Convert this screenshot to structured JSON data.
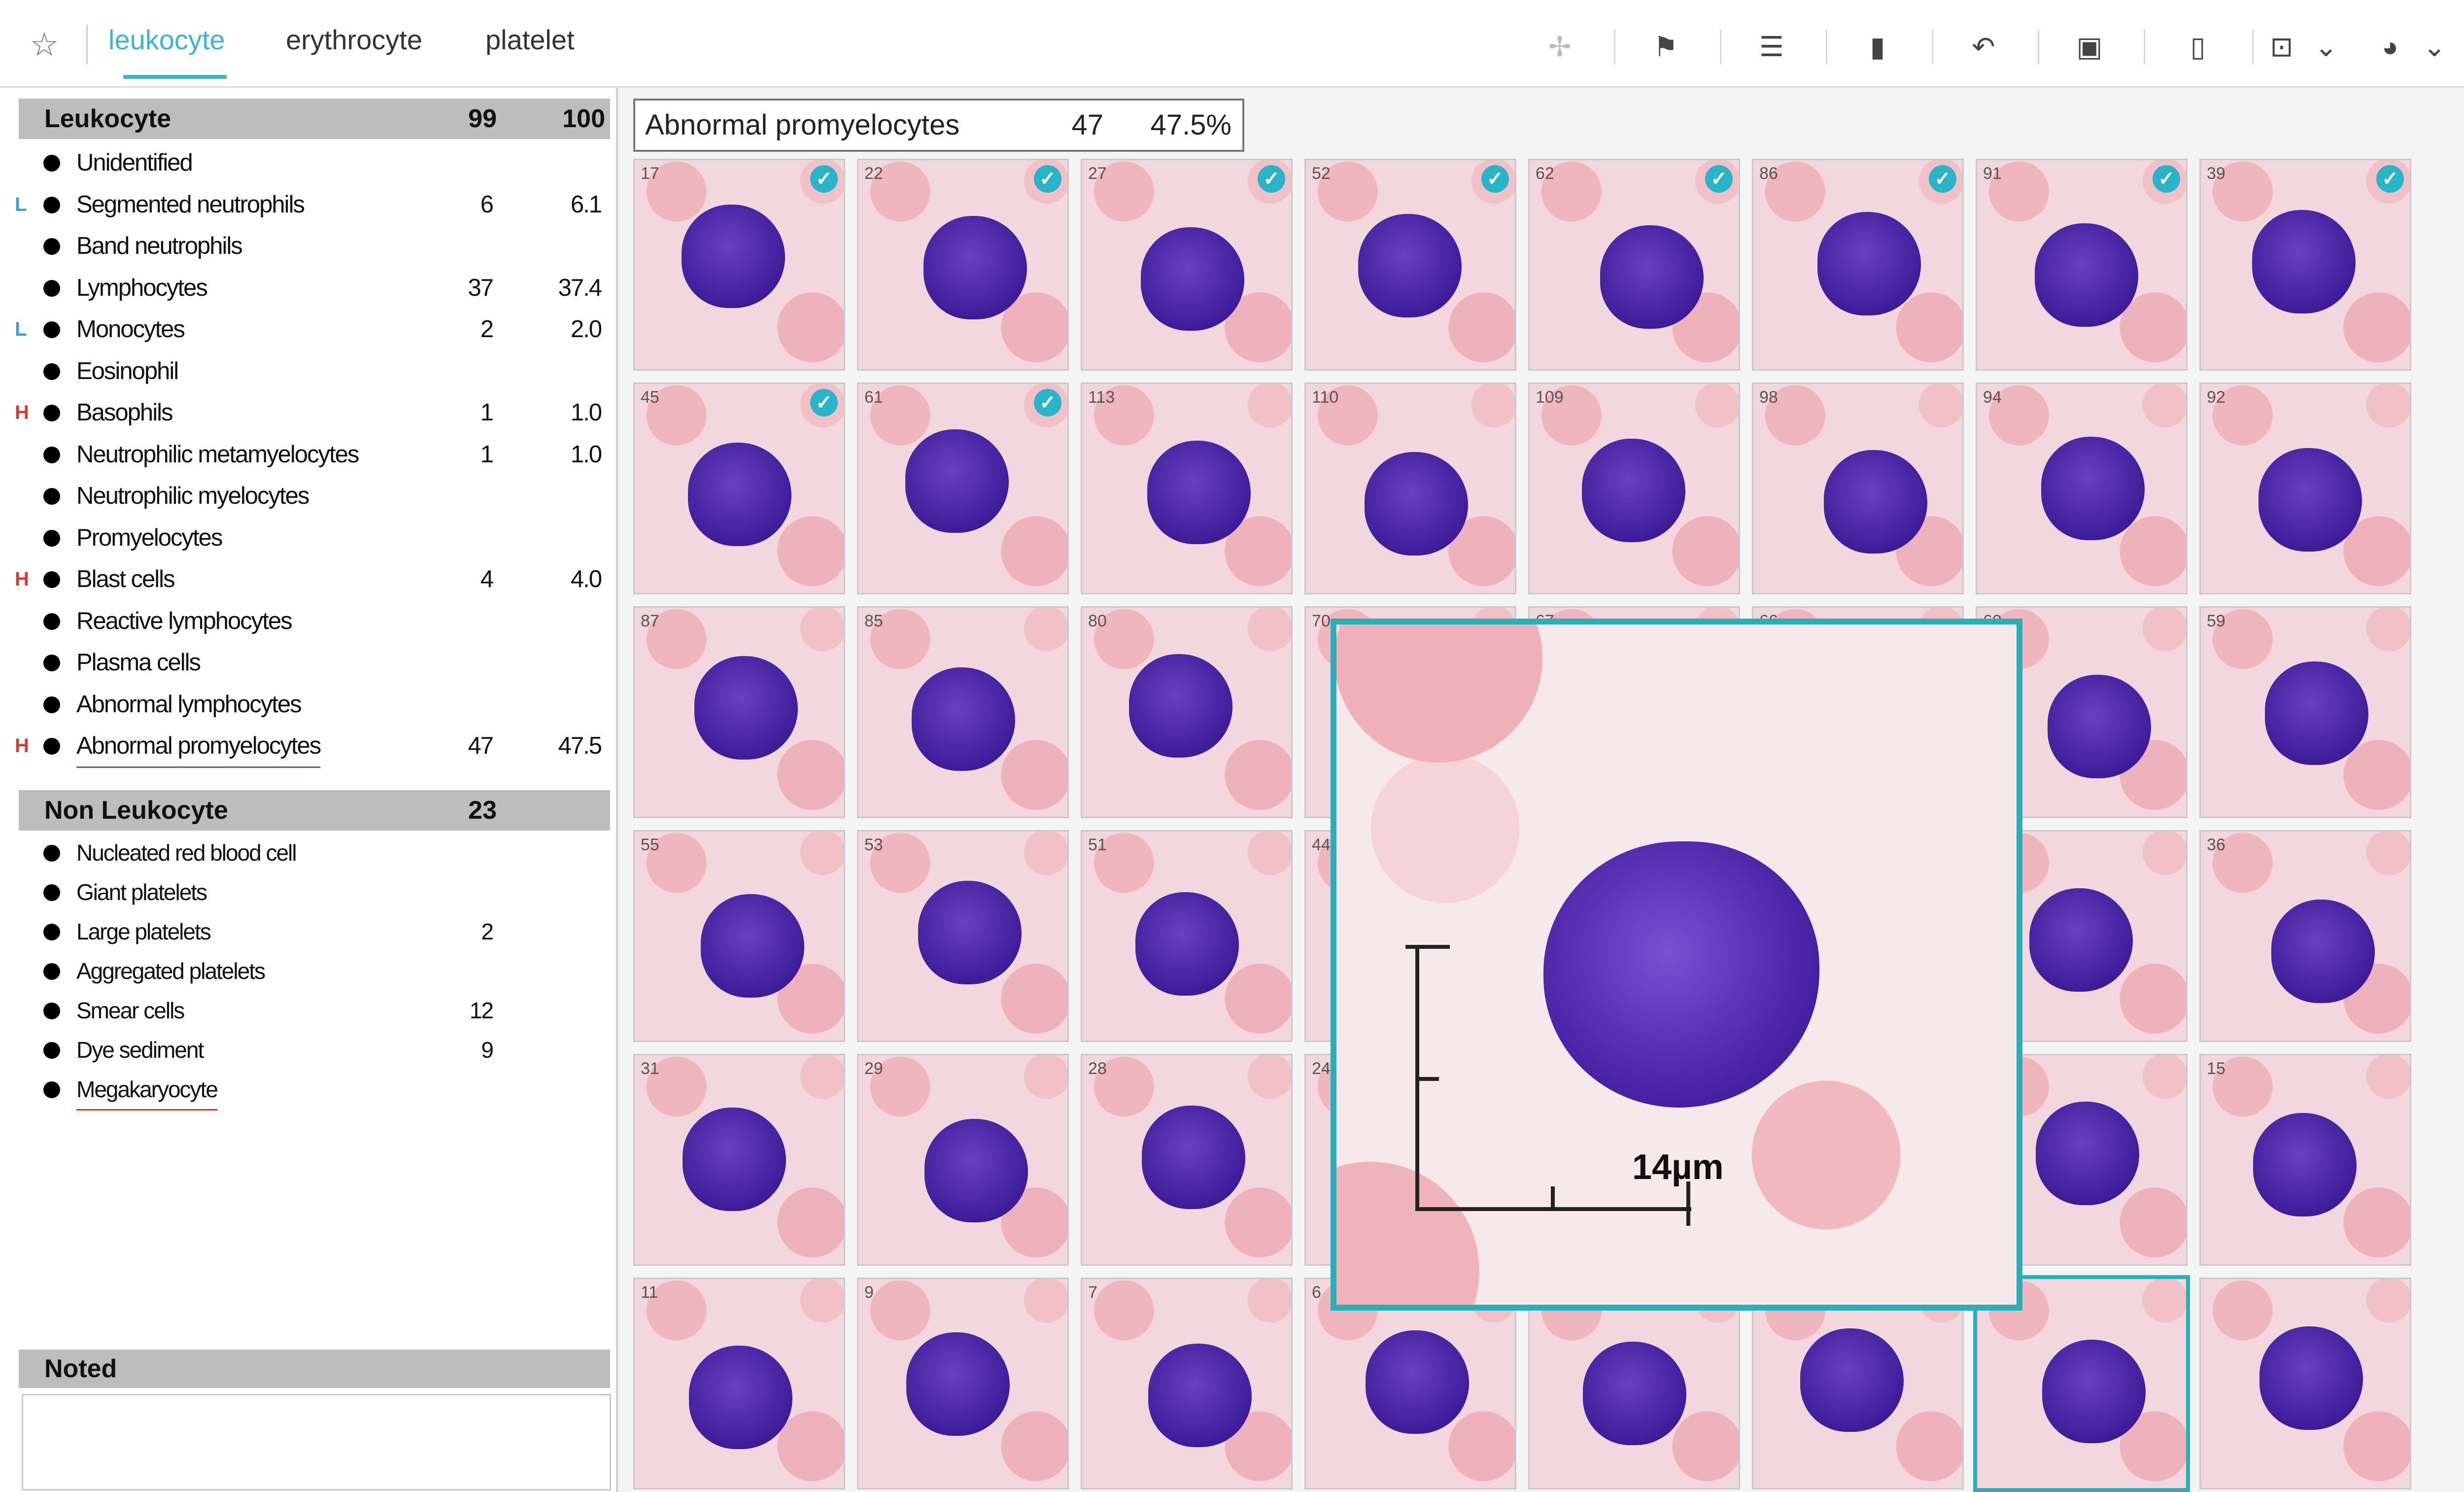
{
  "tabs": [
    {
      "label": "leukocyte"
    },
    {
      "label": "erythrocyte"
    },
    {
      "label": "platelet"
    }
  ],
  "leukocyte_group": {
    "title": "Leukocyte",
    "count": "99",
    "total": "100",
    "rows": [
      {
        "flag": "",
        "label": "Unidentified",
        "count": "",
        "percent": ""
      },
      {
        "flag": "L",
        "label": "Segmented neutrophils",
        "count": "6",
        "percent": "6.1"
      },
      {
        "flag": "",
        "label": "Band neutrophils",
        "count": "",
        "percent": ""
      },
      {
        "flag": "",
        "label": "Lymphocytes",
        "count": "37",
        "percent": "37.4"
      },
      {
        "flag": "L",
        "label": "Monocytes",
        "count": "2",
        "percent": "2.0"
      },
      {
        "flag": "",
        "label": "Eosinophil",
        "count": "",
        "percent": ""
      },
      {
        "flag": "H",
        "label": "Basophils",
        "count": "1",
        "percent": "1.0"
      },
      {
        "flag": "",
        "label": "Neutrophilic metamyelocytes",
        "count": "1",
        "percent": "1.0"
      },
      {
        "flag": "",
        "label": "Neutrophilic myelocytes",
        "count": "",
        "percent": ""
      },
      {
        "flag": "",
        "label": "Promyelocytes",
        "count": "",
        "percent": ""
      },
      {
        "flag": "H",
        "label": "Blast cells",
        "count": "4",
        "percent": "4.0"
      },
      {
        "flag": "",
        "label": "Reactive lymphocytes",
        "count": "",
        "percent": ""
      },
      {
        "flag": "",
        "label": "Plasma cells",
        "count": "",
        "percent": ""
      },
      {
        "flag": "",
        "label": "Abnormal lymphocytes",
        "count": "",
        "percent": ""
      },
      {
        "flag": "H",
        "label": "Abnormal promyelocytes",
        "count": "47",
        "percent": "47.5"
      }
    ]
  },
  "non_leukocyte_group": {
    "title": "Non Leukocyte",
    "count": "23",
    "rows": [
      {
        "label": "Nucleated red blood cell",
        "count": ""
      },
      {
        "label": "Giant platelets",
        "count": ""
      },
      {
        "label": "Large platelets",
        "count": "2"
      },
      {
        "label": "Aggregated platelets",
        "count": ""
      },
      {
        "label": "Smear cells",
        "count": "12"
      },
      {
        "label": "Dye sediment",
        "count": "9"
      },
      {
        "label": "Megakaryocyte",
        "count": ""
      }
    ]
  },
  "noted": {
    "title": "Noted",
    "text": ""
  },
  "selection": {
    "name": "Abnormal promyelocytes",
    "count": "47",
    "percent": "47.5%"
  },
  "cells": {
    "row1": [
      "17",
      "22",
      "27",
      "52",
      "62",
      "86",
      "91",
      "39"
    ],
    "row2": [
      "45",
      "61",
      "113",
      "110",
      "109",
      "98",
      "94",
      "92"
    ],
    "row3": [
      "87",
      "85",
      "80",
      "70",
      "67",
      "66",
      "60",
      "59"
    ],
    "row4": [
      "55",
      "53",
      "51",
      "44",
      "",
      "",
      "",
      "36"
    ],
    "row5": [
      "31",
      "29",
      "28",
      "24",
      "",
      "",
      "",
      "15"
    ],
    "row6": [
      "11",
      "9",
      "7",
      "6",
      "",
      "",
      "",
      ""
    ]
  },
  "checked_cells": [
    "17",
    "22",
    "27",
    "52",
    "62",
    "86",
    "91",
    "39",
    "45",
    "61"
  ],
  "zoom": {
    "scale_label": "14µm"
  },
  "toolbar_icons": [
    "crosshair-icon",
    "flag-icon",
    "align-icon",
    "book-icon",
    "undo-icon",
    "monitor-icon",
    "bookmark-icon",
    "capture-icon",
    "palette-icon",
    "menu-icon"
  ],
  "colors": {
    "accent": "#2aaeb8",
    "flag_high": "#d63a2a",
    "flag_low": "#3aa0d6"
  }
}
